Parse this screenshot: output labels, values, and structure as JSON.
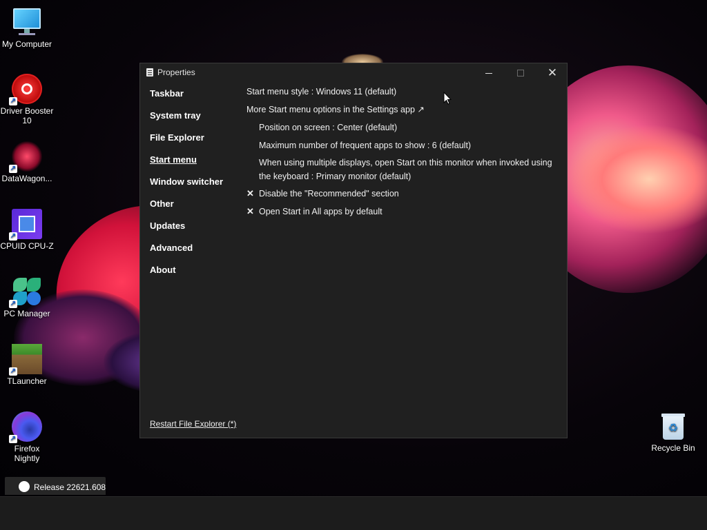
{
  "desktop": {
    "icons": [
      {
        "label": "My Computer",
        "icon": "monitor-icon"
      },
      {
        "label": "Driver Booster 10",
        "label_line1": "Driver Booster",
        "label_line2": "10",
        "icon": "driver-booster-icon"
      },
      {
        "label": "DataWagon...",
        "icon": "datawagon-icon"
      },
      {
        "label": "CPUID CPU-Z",
        "icon": "cpu-z-icon"
      },
      {
        "label": "PC Manager",
        "icon": "pc-manager-icon"
      },
      {
        "label": "TLauncher",
        "icon": "tlauncher-icon"
      },
      {
        "label": "Firefox Nightly",
        "label_line1": "Firefox",
        "label_line2": "Nightly",
        "icon": "firefox-nightly-icon"
      }
    ],
    "recycle_bin": {
      "label": "Recycle Bin",
      "icon": "recycle-bin-icon"
    }
  },
  "window": {
    "title": "Properties",
    "controls": {
      "close_glyph": "✕"
    },
    "nav": [
      {
        "label": "Taskbar",
        "active": false
      },
      {
        "label": "System tray",
        "active": false
      },
      {
        "label": "File Explorer",
        "active": false
      },
      {
        "label": "Start menu",
        "active": true
      },
      {
        "label": "Window switcher",
        "active": false
      },
      {
        "label": "Other",
        "active": false
      },
      {
        "label": "Updates",
        "active": false
      },
      {
        "label": "Advanced",
        "active": false
      },
      {
        "label": "About",
        "active": false
      }
    ],
    "settings": {
      "start_menu_style": "Start menu style : Windows 11 (default)",
      "more_options": "More Start menu options in the Settings app ↗",
      "position": "Position on screen : Center (default)",
      "max_frequent": "Maximum number of frequent apps to show : 6 (default)",
      "multi_display_line1": "When using multiple displays, open Start on this monitor when invoked using",
      "multi_display_line2": "the keyboard : Primary monitor (default)",
      "disable_recommended": "Disable the \"Recommended\" section",
      "open_all_apps": "Open Start in All apps by default",
      "check_glyph": "✕"
    },
    "restart_link": "Restart File Explorer (*)"
  },
  "taskbar": {
    "release_chip": "Release 22621.608..."
  }
}
